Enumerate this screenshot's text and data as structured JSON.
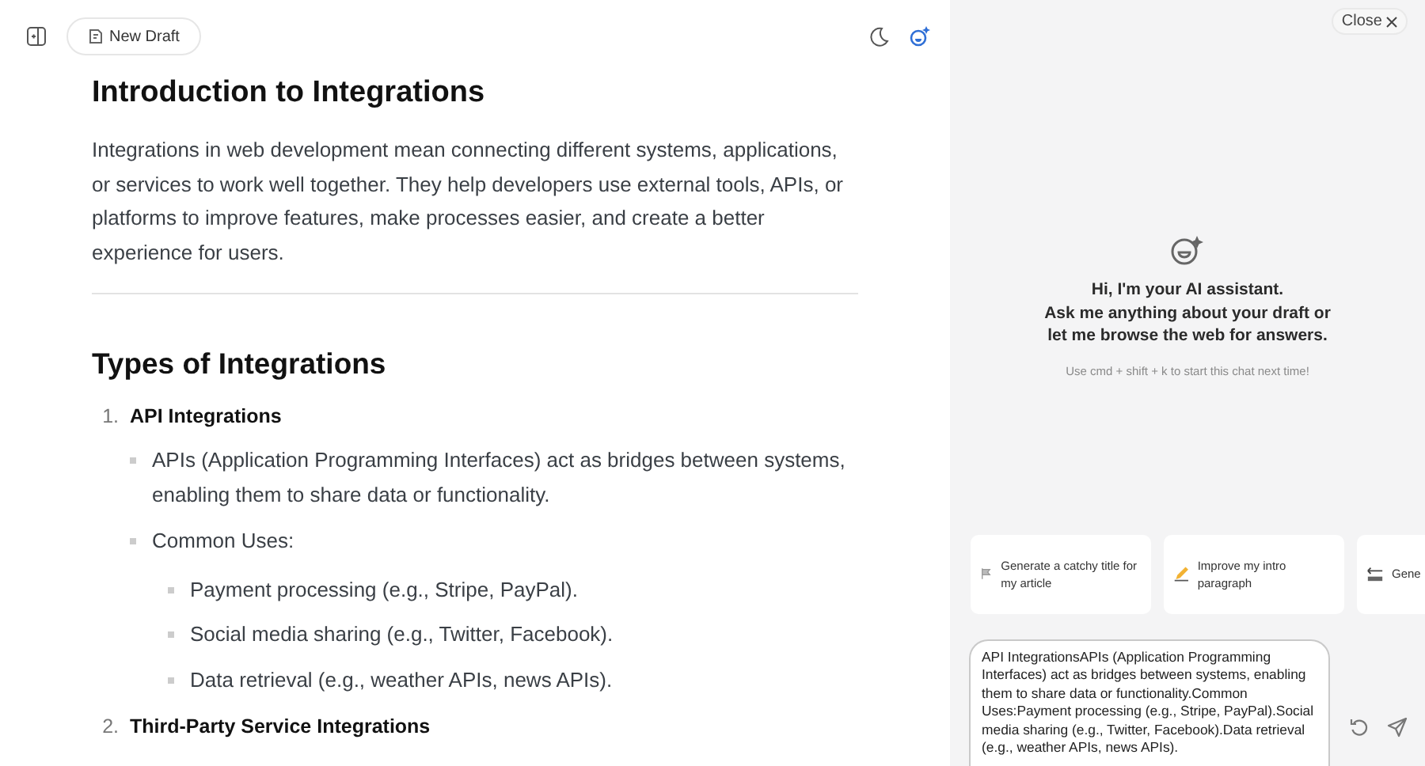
{
  "toolbar": {
    "draft_button": "New Draft"
  },
  "document": {
    "title": "Introduction to Integrations",
    "intro": "Integrations in web development mean connecting different systems, applications, or services to work well together. They help developers use external tools, APIs, or platforms to improve features, make processes easier, and create a better experience for users.",
    "section_title": "Types of Integrations",
    "list": [
      {
        "number": "1.",
        "title": "API Integrations",
        "children": [
          {
            "text": "APIs (Application Programming Interfaces) act as bridges between systems, enabling them to share data or functionality."
          },
          {
            "text": "Common Uses:",
            "children": [
              {
                "text": "Payment processing (e.g., Stripe, PayPal)."
              },
              {
                "text": "Social media sharing (e.g., Twitter, Facebook)."
              },
              {
                "text": "Data retrieval (e.g., weather APIs, news APIs)."
              }
            ]
          }
        ]
      },
      {
        "number": "2.",
        "title": "Third-Party Service Integrations"
      }
    ]
  },
  "assistant": {
    "close_button": "Close",
    "greeting": [
      "Hi, I'm your AI assistant.",
      "Ask me anything about your draft or",
      "let me browse the web for answers."
    ],
    "hint": "Use cmd + shift + k to start this chat next time!",
    "suggestions": [
      {
        "kind": "flag",
        "text": "Generate a catchy title for my article"
      },
      {
        "kind": "pencil",
        "text": "Improve my intro paragraph"
      },
      {
        "kind": "end",
        "text": "Gene"
      }
    ],
    "input": {
      "value": "API IntegrationsAPIs (Application Programming Interfaces) act as bridges between systems, enabling them to share data or functionality.Common Uses:Payment processing (e.g., Stripe, PayPal).Social media sharing (e.g., Twitter, Facebook).Data retrieval (e.g., weather APIs, news APIs)."
    }
  }
}
